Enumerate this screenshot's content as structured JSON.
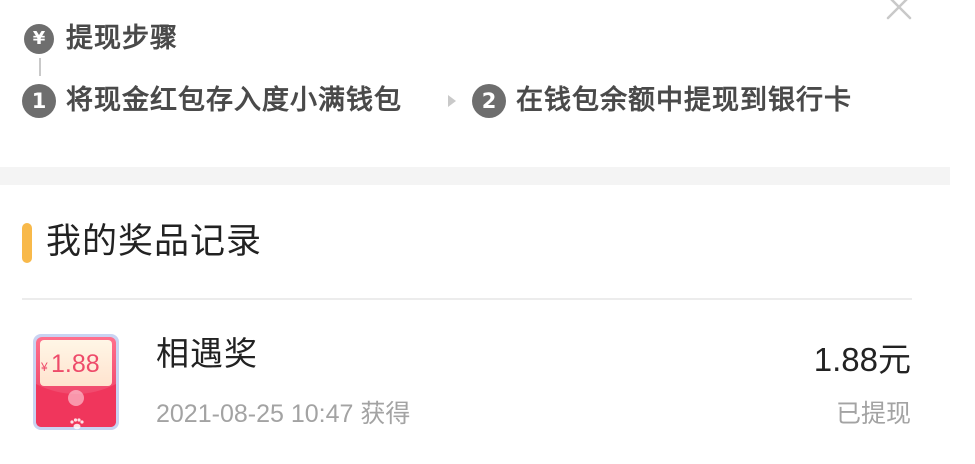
{
  "withdraw_steps": {
    "badge_symbol": "¥",
    "title": "提现步骤",
    "steps": [
      {
        "number": "1",
        "text": "将现金红包存入度小满钱包"
      },
      {
        "number": "2",
        "text": "在钱包余额中提现到银行卡"
      }
    ]
  },
  "records": {
    "title": "我的奖品记录",
    "items": [
      {
        "icon_currency": "¥",
        "icon_amount": "1.88",
        "name": "相遇奖",
        "date": "2021-08-25 10:47 获得",
        "amount": "1.88元",
        "status": "已提现"
      }
    ]
  },
  "colors": {
    "accent_bar": "#f8b94a",
    "badge_gray": "#6e6e6e",
    "envelope_pink": "#ee4b6a",
    "muted_text": "#a3a3a3"
  },
  "icons": [
    "close-icon",
    "yen-icon",
    "arrow-right-icon",
    "red-envelope-icon",
    "paw-icon"
  ]
}
